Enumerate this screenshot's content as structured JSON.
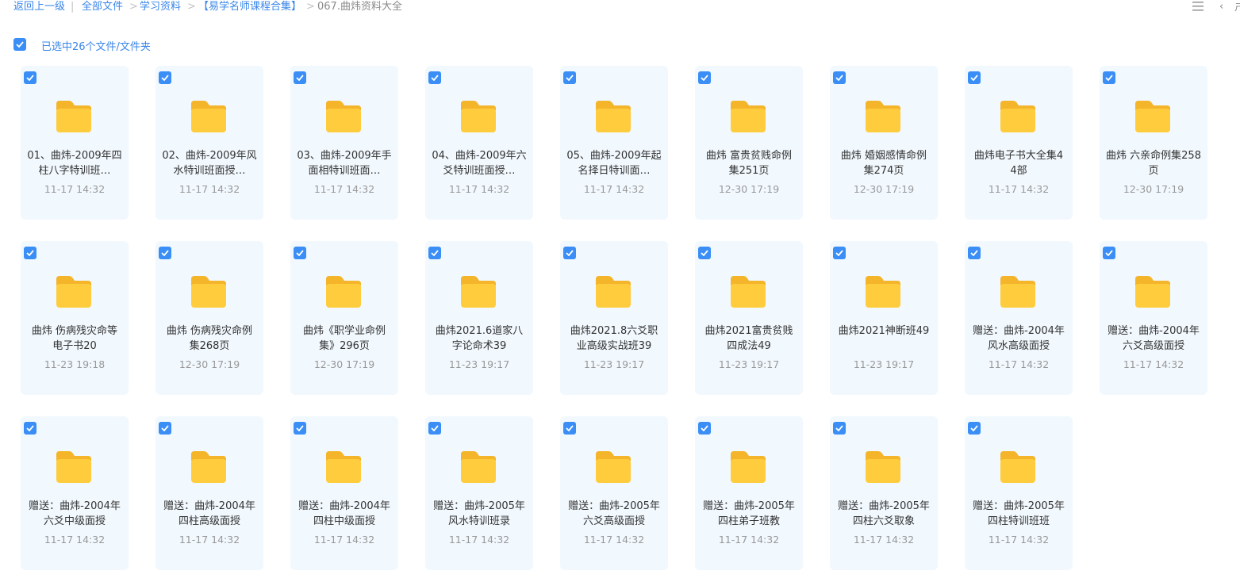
{
  "breadcrumb": {
    "back": "返回上一级",
    "separator": "|",
    "arrow": ">",
    "items": [
      "全部文件",
      "学习资料",
      "【易学名师课程合集】"
    ],
    "current": "067.曲炜资料大全"
  },
  "toolbar": {
    "view_icon": "list-view-icon",
    "back_icon": "chevron-left-icon",
    "edge_glyph": "ㄕ"
  },
  "selection": {
    "label": "已选中26个文件/文件夹",
    "checked": true
  },
  "accent_color": "#3a8ef6",
  "folder_color": "#ffc93c",
  "files": [
    {
      "name": "01、曲炜-2009年四柱八字特训班…",
      "time": "11-17 14:32"
    },
    {
      "name": "02、曲炜-2009年风水特训班面授…",
      "time": "11-17 14:32"
    },
    {
      "name": "03、曲炜-2009年手面相特训班面…",
      "time": "11-17 14:32"
    },
    {
      "name": "04、曲炜-2009年六爻特训班面授…",
      "time": "11-17 14:32"
    },
    {
      "name": "05、曲炜-2009年起名择日特训面…",
      "time": "11-17 14:32"
    },
    {
      "name": "曲炜 富贵贫贱命例集251页",
      "time": "12-30 17:19"
    },
    {
      "name": "曲炜 婚姻感情命例集274页",
      "time": "12-30 17:19"
    },
    {
      "name": "曲炜电子书大全集44部",
      "time": "11-17 14:32"
    },
    {
      "name": "曲炜 六亲命例集258页",
      "time": "12-30 17:19"
    },
    {
      "name": "曲炜 伤病残灾命等电子书20",
      "time": "11-23 19:18"
    },
    {
      "name": "曲炜 伤病残灾命例集268页",
      "time": "12-30 17:19"
    },
    {
      "name": "曲炜《职学业命例集》296页",
      "time": "12-30 17:19"
    },
    {
      "name": "曲炜2021.6道家八字论命术39",
      "time": "11-23 19:17"
    },
    {
      "name": "曲炜2021.8六爻职业高级实战班39",
      "time": "11-23 19:17"
    },
    {
      "name": "曲炜2021富贵贫贱四成法49",
      "time": "11-23 19:17"
    },
    {
      "name": "曲炜2021神断班49",
      "time": "11-23 19:17"
    },
    {
      "name": "赠送：曲炜-2004年风水高级面授",
      "time": "11-17 14:32"
    },
    {
      "name": "赠送：曲炜-2004年六爻高级面授",
      "time": "11-17 14:32"
    },
    {
      "name": "赠送：曲炜-2004年六爻中级面授",
      "time": "11-17 14:32"
    },
    {
      "name": "赠送：曲炜-2004年四柱高级面授",
      "time": "11-17 14:32"
    },
    {
      "name": "赠送：曲炜-2004年四柱中级面授",
      "time": "11-17 14:32"
    },
    {
      "name": "赠送：曲炜-2005年风水特训班录",
      "time": "11-17 14:32"
    },
    {
      "name": "赠送：曲炜-2005年六爻高级面授",
      "time": "11-17 14:32"
    },
    {
      "name": "赠送：曲炜-2005年四柱弟子班教",
      "time": "11-17 14:32"
    },
    {
      "name": "赠送：曲炜-2005年四柱六爻取象",
      "time": "11-17 14:32"
    },
    {
      "name": "赠送：曲炜-2005年四柱特训班班",
      "time": "11-17 14:32"
    }
  ]
}
